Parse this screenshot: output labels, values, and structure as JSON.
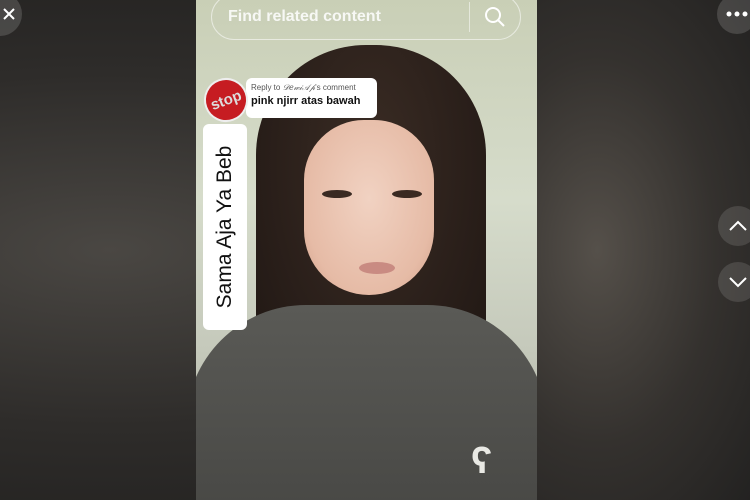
{
  "search": {
    "placeholder": "Find related content"
  },
  "reply_sticker": {
    "prefix": "Reply to ",
    "username": "𝒟𝑒𝓌𝒾𝒜𝓅",
    "suffix": "'s comment",
    "comment": "pink njirr atas bawah",
    "avatar_text": "stop"
  },
  "caption_vertical": "Sama Aja Ya Beb",
  "icons": [
    "close-icon",
    "search-icon",
    "more-icon",
    "chevron-up-icon",
    "chevron-down-icon"
  ]
}
